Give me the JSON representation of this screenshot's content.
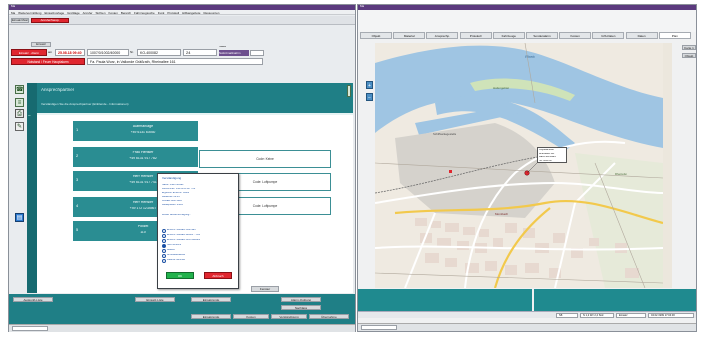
{
  "left": {
    "title": "Ma",
    "menu": [
      "Ma",
      "Weitervermittlung",
      "Einsatzvorlage",
      "Großlage",
      "Anrufer",
      "Sichten",
      "Kosten",
      "Bereich",
      "Fahrzeugsuche",
      "Funk",
      "Protokoll",
      "Hilfsangebote",
      "Ressourcen"
    ],
    "tabs": {
      "tab1": "Einsatz/Alarm",
      "tab2": "Anrufer/Gesp."
    },
    "header_label": "Einsatz",
    "call": {
      "status": "Einsatz · Alarm",
      "date_label": "am",
      "date": "25.08.18 09:40",
      "code": "1007/0/1002/40000",
      "ref_label": "Nr.",
      "ref_value": "KO-400082",
      "num": "24",
      "status_label": "Status",
      "status_value": "Sofortmaßnahm"
    },
    "alert_text": "Notstand / Feuer Hauptalarm",
    "address": "Fa. Paula Wurz, in Vallonde Gräßrath, Rheinallee 161",
    "panel_title": "Ansprechpartner",
    "panel_subtitle": "Verständigen Sie die Ansprechpartner (Einblende - Informationen)",
    "contacts": [
      {
        "num": "1",
        "name": "Alarmanlage",
        "phone": "+49 6131 63930"
      },
      {
        "num": "2",
        "name": "Frau Hensler",
        "phone": "+49 6131 917 782"
      },
      {
        "num": "3",
        "name": "Herr Hensler",
        "phone": "+49 6131 917 741"
      },
      {
        "num": "4",
        "name": "Herr Hensler",
        "phone": "+49 172 1234567"
      },
      {
        "num": "5",
        "name": "Polizei",
        "phone": "110"
      }
    ],
    "results": [
      "Code: Keine",
      "Code: Luftpumpe",
      "Code: Luftpumpe"
    ],
    "popup": {
      "title": "Verständigung",
      "lines": [
        "Name: Frau Hensler",
        "Rufnummer: +49 6131 917 782",
        "Ergebnis: Erreicht / Keine",
        "Meldezeit: 09:44",
        "Kontakt: Ebu 1999",
        "Meldeposten: Intern"
      ],
      "question": "Weiter Benachrichtigung?",
      "options": [
        "Erreicht / Einsatz informiert",
        "Erreicht / Einsatz bereits ... info",
        "Erreicht / Einsatz nicht relevant",
        "Nicht erreicht",
        "Besetzt",
        "Anrufbeantworter",
        "Falsche Nummer"
      ],
      "ok": "OK",
      "cancel": "Abbruch"
    },
    "footer": {
      "close": "Fenster",
      "b1": "Auskunft-Liste",
      "b2": "Einsatz-Liste",
      "b3": "Einsatzende",
      "b4": "Alarm-Quittung",
      "b5": "Nachlass",
      "b6": "Einsatzende",
      "b7": "Kosten",
      "b8": "Verständigung",
      "b9": "Übernahme",
      "b10": "Status",
      "b11": "Drucken"
    }
  },
  "right": {
    "title": "Ma",
    "tabs": [
      "Objekt",
      "Material",
      "Ansprechp.",
      "Protokoll",
      "Fahrzeuge",
      "Sonderalarm",
      "Kosten",
      "GIS-Daten",
      "Daten",
      "Plan"
    ],
    "sidebar": [
      "Karte 1",
      "Objekt"
    ],
    "map": {
      "river_label": "Rhein",
      "label_a": "Hafengebiet",
      "label_b": "Schiffsanlegestelle",
      "label_c": "Mombach",
      "label_d": "Rheinufer",
      "popup": [
        "Objektadresse",
        "Rheinallee 161",
        "Mainz-Mombach",
        "Tel: 0000-00"
      ]
    },
    "status": {
      "s1": "N8",
      "s2": "N 1,2 Wz 2,4 Süd",
      "s3": "Einsatz",
      "s4": "04.02.1999 17:04:30"
    }
  }
}
